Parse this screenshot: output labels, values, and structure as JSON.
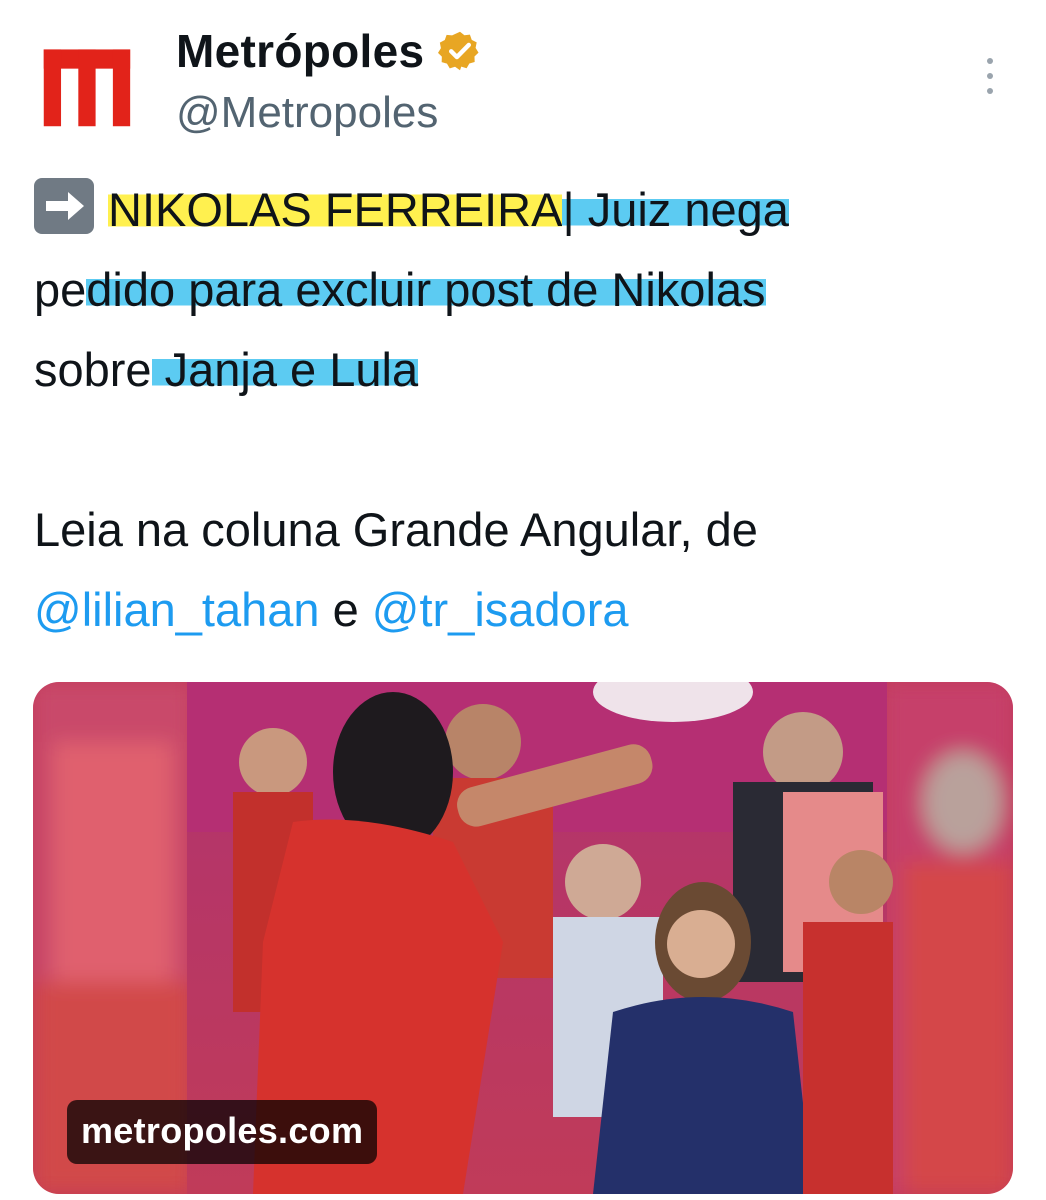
{
  "author": {
    "name": "Metrópoles",
    "handle": "@Metropoles",
    "avatar_letter": "m",
    "avatar_color": "#e2231a",
    "verified_icon": "gold-verified-badge-icon",
    "verified_color": "#e8a623"
  },
  "more_icon": "more-vertical-icon",
  "tweet": {
    "emoji": "right-arrow-emoji-icon",
    "line1_highlight_yellow": "NIKOLAS FERREIRA",
    "line1_rest": "| Juiz nega",
    "line2_plain": "pe",
    "line2_highlight": "dido para excluir post de Nikolas",
    "line3_plain": "sobre",
    "line3_highlight": " Janja e Lula ",
    "line4": "Leia na coluna Grande Angular, de",
    "mention1": "@lilian_tahan",
    "connector": " e ",
    "mention2": "@tr_isadora",
    "link_color": "#1d9bf0",
    "highlight_yellow": "#fff04f",
    "highlight_blue": "#5ccbf2"
  },
  "media": {
    "source_label": "metropoles.com",
    "image_subject": "event-photo"
  }
}
